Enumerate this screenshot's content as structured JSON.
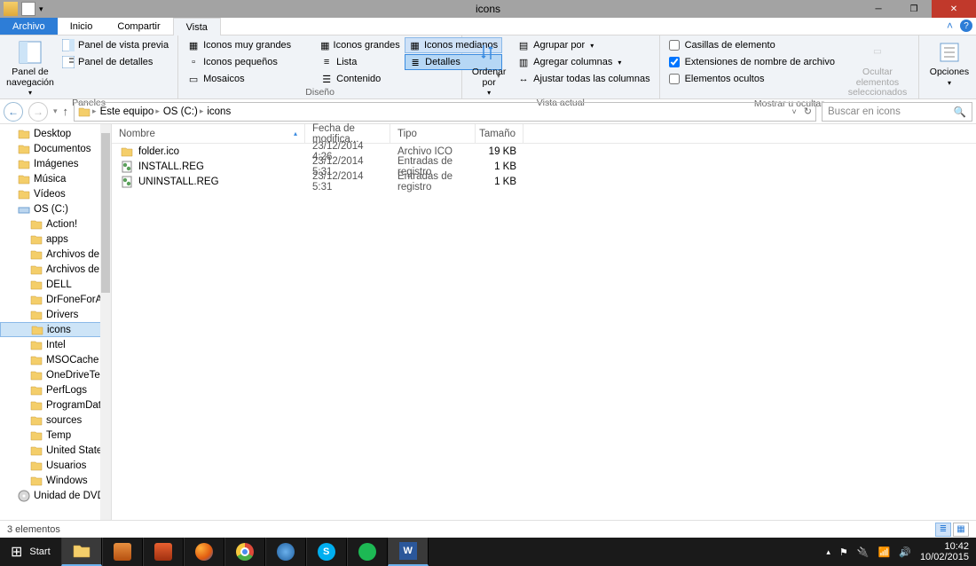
{
  "window": {
    "title": "icons"
  },
  "tabs": {
    "file": "Archivo",
    "home": "Inicio",
    "share": "Compartir",
    "view": "Vista"
  },
  "ribbon": {
    "nav_panel": "Panel de\nnavegación",
    "preview_pane": "Panel de vista previa",
    "details_pane": "Panel de detalles",
    "grp_panels": "Paneles",
    "icons_xl": "Iconos muy grandes",
    "icons_l": "Iconos grandes",
    "icons_m": "Iconos medianos",
    "icons_s": "Iconos pequeños",
    "list": "Lista",
    "details": "Detalles",
    "tiles": "Mosaicos",
    "content": "Contenido",
    "grp_layout": "Diseño",
    "sort_by": "Ordenar\npor",
    "group_by": "Agrupar por",
    "add_cols": "Agregar columnas",
    "fit_cols": "Ajustar todas las columnas",
    "grp_current": "Vista actual",
    "chk_item": "Casillas de elemento",
    "chk_ext": "Extensiones de nombre de archivo",
    "chk_hidden": "Elementos ocultos",
    "hide_sel": "Ocultar elementos\nseleccionados",
    "grp_show": "Mostrar u ocultar",
    "options": "Opciones"
  },
  "breadcrumb": {
    "c1": "Este equipo",
    "c2": "OS (C:)",
    "c3": "icons"
  },
  "search": {
    "placeholder": "Buscar en icons"
  },
  "columns": {
    "name": "Nombre",
    "date": "Fecha de modifica...",
    "type": "Tipo",
    "size": "Tamaño"
  },
  "files": [
    {
      "name": "folder.ico",
      "date": "23/12/2014 4:26",
      "type": "Archivo ICO",
      "size": "19 KB",
      "icon": "folder"
    },
    {
      "name": "INSTALL.REG",
      "date": "23/12/2014 5:31",
      "type": "Entradas de registro",
      "size": "1 KB",
      "icon": "reg"
    },
    {
      "name": "UNINSTALL.REG",
      "date": "23/12/2014 5:31",
      "type": "Entradas de registro",
      "size": "1 KB",
      "icon": "reg"
    }
  ],
  "tree": [
    {
      "label": "Desktop",
      "d": 0
    },
    {
      "label": "Documentos",
      "d": 0
    },
    {
      "label": "Imágenes",
      "d": 0
    },
    {
      "label": "Música",
      "d": 0
    },
    {
      "label": "Vídeos",
      "d": 0
    },
    {
      "label": "OS (C:)",
      "d": 0,
      "drive": true
    },
    {
      "label": "Action!",
      "d": 1
    },
    {
      "label": "apps",
      "d": 1
    },
    {
      "label": "Archivos de pro",
      "d": 1
    },
    {
      "label": "Archivos de pro",
      "d": 1
    },
    {
      "label": "DELL",
      "d": 1
    },
    {
      "label": "DrFoneForAndr",
      "d": 1
    },
    {
      "label": "Drivers",
      "d": 1
    },
    {
      "label": "icons",
      "d": 1,
      "sel": true
    },
    {
      "label": "Intel",
      "d": 1
    },
    {
      "label": "MSOCache",
      "d": 1
    },
    {
      "label": "OneDriveTemp",
      "d": 1
    },
    {
      "label": "PerfLogs",
      "d": 1
    },
    {
      "label": "ProgramData",
      "d": 1
    },
    {
      "label": "sources",
      "d": 1
    },
    {
      "label": "Temp",
      "d": 1
    },
    {
      "label": "United States S",
      "d": 1
    },
    {
      "label": "Usuarios",
      "d": 1
    },
    {
      "label": "Windows",
      "d": 1
    },
    {
      "label": "Unidad de DVD R",
      "d": 0,
      "dvd": true
    }
  ],
  "status": {
    "count": "3 elementos"
  },
  "taskbar": {
    "start": "Start",
    "time": "10:42",
    "date": "10/02/2015"
  }
}
